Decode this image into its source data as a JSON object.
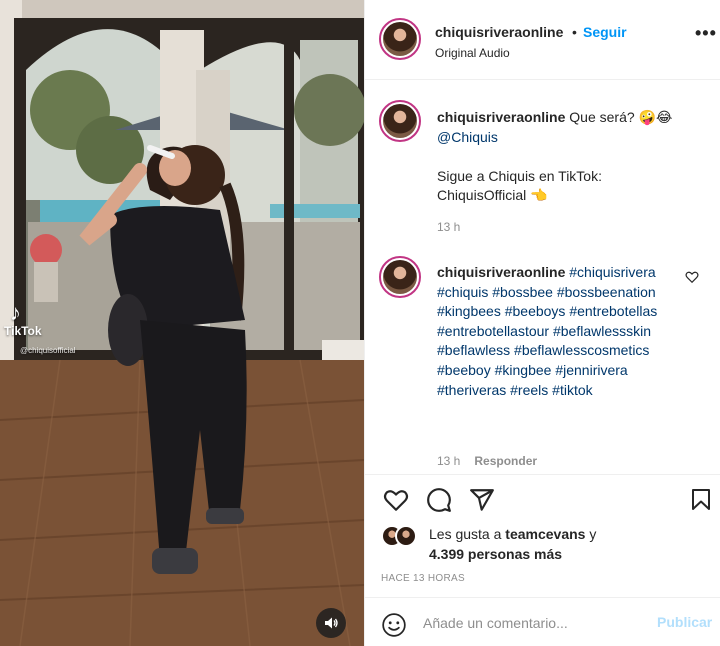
{
  "post": {
    "username": "chiquisriveraonline",
    "dot": "•",
    "follow_label": "Seguir",
    "audio": "Original Audio",
    "more": "•••"
  },
  "caption": {
    "username": "chiquisriveraonline",
    "text": "Que será? 🤪😂",
    "mention": "@Chiquis",
    "line2": "Sigue a Chiquis en TikTok:",
    "line3": "ChiquisOfficial 👈",
    "time": "13 h"
  },
  "comment": {
    "username": "chiquisriveraonline",
    "hashtags": "#chiquisrivera #chiquis #bossbee #bossbeenation #kingbees #beeboys #entrebotellas #entrebotellastour #beflawlessskin #beflawless #beflawlesscosmetics #beeboy #kingbee #jennirivera #theriveras #reels #tiktok",
    "time": "13 h",
    "reply_label": "Responder"
  },
  "likes": {
    "prefix": "Les gusta a",
    "user": "teamcevans",
    "connector": "y",
    "count": "4.399 personas más"
  },
  "timestamp": "HACE 13 HORAS",
  "composer": {
    "placeholder": "Añade un comentario...",
    "publish_label": "Publicar"
  },
  "video_overlay": {
    "brand": "TikTok",
    "handle": "@chiquisofficial"
  },
  "colors": {
    "accent": "#0095f6",
    "publish_disabled": "#b2dffc",
    "hashtag": "#00376b",
    "muted": "#8e8e8e"
  },
  "icons": [
    "heart-icon",
    "comment-icon",
    "share-icon",
    "bookmark-icon",
    "emoji-icon",
    "volume-icon",
    "more-icon"
  ]
}
